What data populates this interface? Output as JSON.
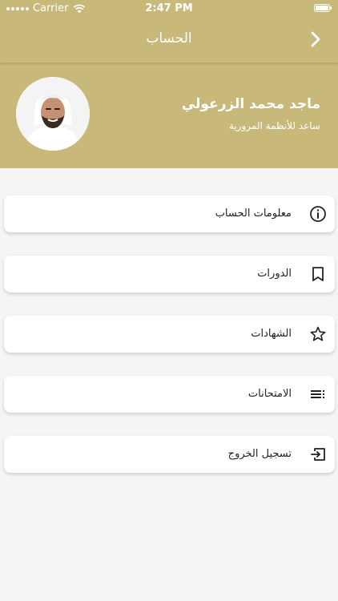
{
  "status_bar": {
    "carrier": "Carrier",
    "time": "2:47 PM"
  },
  "nav": {
    "title": "الحساب",
    "back_icon": "chevron-right-icon"
  },
  "profile": {
    "name": "ماجد محمد الزرعولي",
    "role": "ساعد للأنظمة المرورية",
    "avatar_icon": "avatar-photo"
  },
  "menu": {
    "items": [
      {
        "label": "معلومات الحساب",
        "icon": "info-icon"
      },
      {
        "label": "الدورات",
        "icon": "bookmark-icon"
      },
      {
        "label": "الشهادات",
        "icon": "star-icon"
      },
      {
        "label": "الامتحانات",
        "icon": "list-icon"
      },
      {
        "label": "تسجيل الخروج",
        "icon": "logout-icon"
      }
    ]
  },
  "colors": {
    "header_gold": "#c8b97a",
    "background": "#f5f5f5",
    "card": "#ffffff",
    "text_dark": "#222222"
  }
}
